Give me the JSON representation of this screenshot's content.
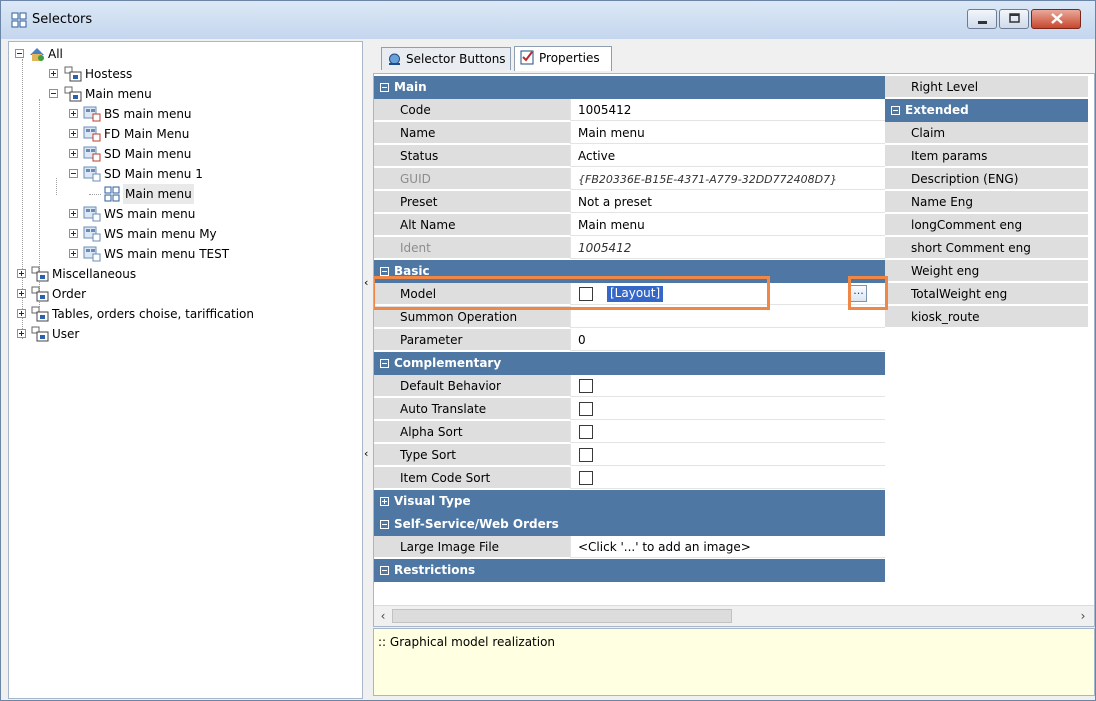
{
  "window": {
    "title": "Selectors"
  },
  "tree": {
    "root": "All",
    "items": [
      {
        "label": "Hostess"
      },
      {
        "label": "Main menu"
      },
      {
        "label": "BS main menu"
      },
      {
        "label": "FD Main Menu"
      },
      {
        "label": "SD Main menu"
      },
      {
        "label": "SD Main menu 1"
      },
      {
        "label": "Main menu"
      },
      {
        "label": "WS main menu"
      },
      {
        "label": "WS main menu My"
      },
      {
        "label": "WS main menu TEST"
      },
      {
        "label": "Miscellaneous"
      },
      {
        "label": "Order"
      },
      {
        "label": "Tables, orders choise, tariffication"
      },
      {
        "label": "User"
      }
    ]
  },
  "tabs": [
    {
      "label": "Selector Buttons"
    },
    {
      "label": "Properties"
    }
  ],
  "grid": {
    "main": {
      "title": "Main",
      "rows": [
        {
          "name": "Code",
          "value": "1005412"
        },
        {
          "name": "Name",
          "value": "Main menu"
        },
        {
          "name": "Status",
          "value": "Active"
        },
        {
          "name": "GUID",
          "value": "{FB20336E-B15E-4371-A779-32DD772408D7}"
        },
        {
          "name": "Preset",
          "value": "Not a preset"
        },
        {
          "name": "Alt Name",
          "value": "Main menu"
        },
        {
          "name": "Ident",
          "value": "1005412"
        }
      ]
    },
    "basic": {
      "title": "Basic",
      "model": {
        "name": "Model",
        "value": "[Layout]",
        "button": "..."
      },
      "summon": {
        "name": "Summon Operation",
        "value": ""
      },
      "parameter": {
        "name": "Parameter",
        "value": "0"
      }
    },
    "complementary": {
      "title": "Complementary",
      "rows": [
        {
          "name": "Default Behavior"
        },
        {
          "name": "Auto Translate"
        },
        {
          "name": "Alpha Sort"
        },
        {
          "name": "Type Sort"
        },
        {
          "name": "Item Code Sort"
        }
      ]
    },
    "visual_type": {
      "title": "Visual Type"
    },
    "self_service": {
      "title": "Self-Service/Web Orders",
      "large_image": {
        "name": "Large Image File",
        "value": "<Click '...' to add an image>"
      }
    },
    "restrictions": {
      "title": "Restrictions"
    },
    "right_column": {
      "top": "Right Level",
      "extended_title": "Extended",
      "rows": [
        "Claim",
        "Item params",
        "Description (ENG)",
        "Name Eng",
        "longComment eng",
        "short Comment eng",
        "Weight eng",
        "TotalWeight eng",
        "kiosk_route"
      ]
    }
  },
  "description": ":: Graphical model realization",
  "colors": {
    "category": "#4e78a3",
    "highlight": "#ef8847",
    "selection": "#3467c8",
    "description_bg": "#ffffe1"
  }
}
